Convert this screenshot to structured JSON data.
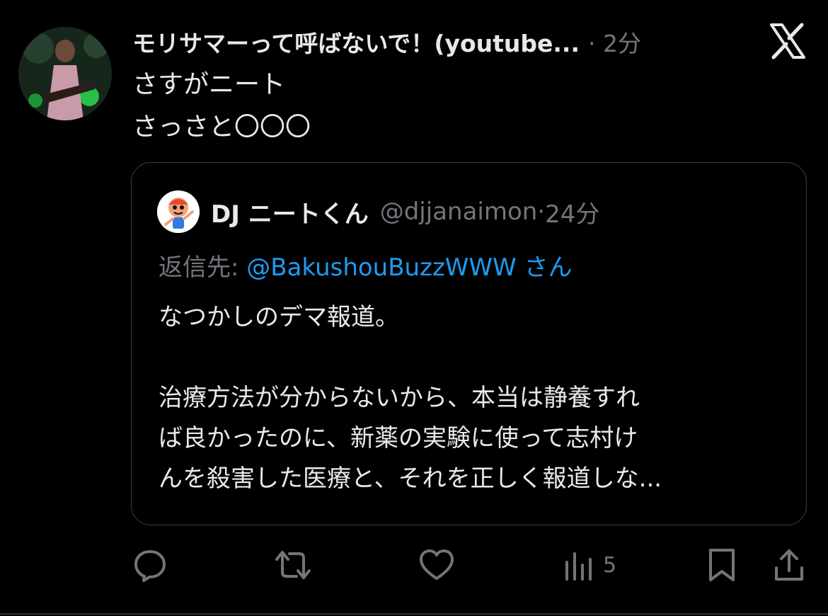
{
  "tweet": {
    "author_name": "モリサマーって呼ばないで！(youtube...",
    "separator": "·",
    "time": "2分",
    "text": "さすがニート\nさっさと〇〇〇"
  },
  "quote": {
    "author_name": "DJ ニートくん",
    "handle": "@djjanaimon",
    "separator": "·",
    "time": "24分",
    "reply_prefix": "返信先: ",
    "reply_mention": "@BakushouBuzzWWW",
    "reply_suffix": " さん",
    "body": "なつかしのデマ報道。\n\n治療方法が分からないから、本当は静養すれ\nば良かったのに、新薬の実験に使って志村け\nんを殺害した医療と、それを正しく報道しな..."
  },
  "actions": {
    "views_count": "5"
  },
  "icons": {
    "x_logo": "x-logo-icon",
    "reply": "reply-icon",
    "retweet": "retweet-icon",
    "like": "heart-icon",
    "views": "views-icon",
    "bookmark": "bookmark-icon",
    "share": "share-icon"
  },
  "colors": {
    "background": "#000000",
    "text_primary": "#e7e9ea",
    "text_secondary": "#71767b",
    "link": "#1d9bf0",
    "border": "#3a3d40"
  }
}
